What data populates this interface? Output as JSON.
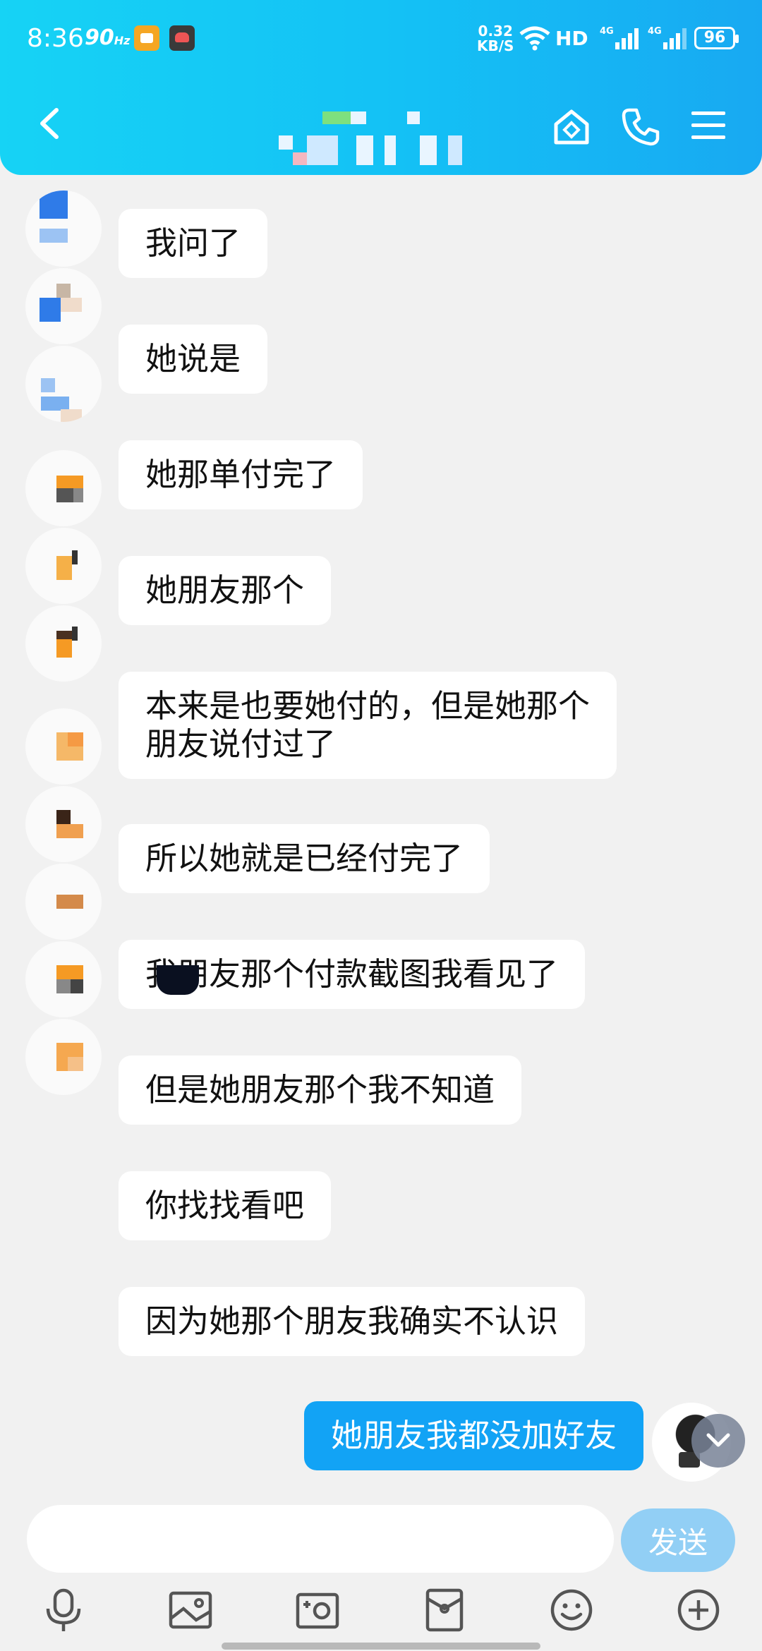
{
  "status_bar": {
    "time": "8:36",
    "refresh_rate": "90",
    "refresh_unit": "Hz",
    "net_speed_value": "0.32",
    "net_speed_unit": "KB/S",
    "hd_label": "HD",
    "battery": "96"
  },
  "colors": {
    "header_gradient_start": "#16d3f5",
    "header_gradient_end": "#18a9f2",
    "my_bubble": "#12a3f5",
    "their_bubble": "#ffffff",
    "background": "#f1f1f1",
    "send_button": "#92cff5"
  },
  "header": {
    "back_icon": "chevron-left-icon",
    "right_icons": [
      "home-icon",
      "phone-icon",
      "menu-icon"
    ]
  },
  "messages": [
    {
      "from": "them",
      "text": "我问了"
    },
    {
      "from": "them",
      "text": "她说是"
    },
    {
      "from": "them",
      "text": "她那单付完了"
    },
    {
      "from": "them",
      "text": "她朋友那个"
    },
    {
      "from": "them",
      "text": "本来是也要她付的，但是她那个\n朋友说付过了"
    },
    {
      "from": "them",
      "text": "所以她就是已经付完了"
    },
    {
      "from": "them",
      "text": "我朋友那个付款截图我看见了"
    },
    {
      "from": "them",
      "text": "但是她朋友那个我不知道"
    },
    {
      "from": "them",
      "text": "你找找看吧"
    },
    {
      "from": "them",
      "text": "因为她那个朋友我确实不认识"
    },
    {
      "from": "me",
      "text": "她朋友我都没加好友"
    }
  ],
  "input": {
    "placeholder": "",
    "send_label": "发送"
  },
  "toolbar": [
    "microphone-icon",
    "image-icon",
    "camera-icon",
    "red-packet-icon",
    "emoji-icon",
    "plus-icon"
  ]
}
